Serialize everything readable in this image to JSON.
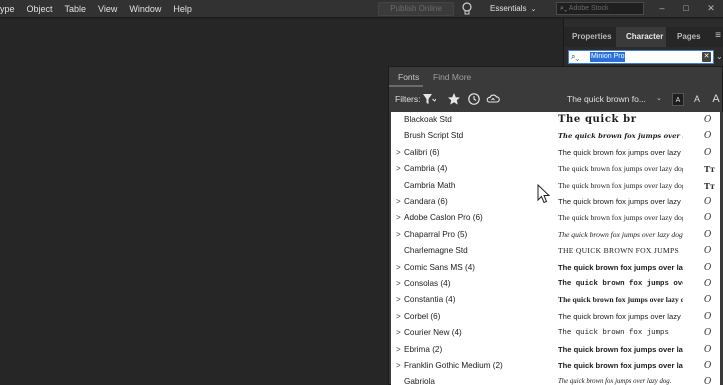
{
  "menubar": {
    "items": [
      "ype",
      "Object",
      "Table",
      "View",
      "Window",
      "Help"
    ],
    "publish_label": "Publish Online",
    "workspace_label": "Essentials",
    "stock_placeholder": "Adobe Stock"
  },
  "right_panel": {
    "tabs": [
      "Properties",
      "Character",
      "Pages"
    ],
    "font_field_value": "Minion Pro"
  },
  "fonts_popup": {
    "tabs": [
      "Fonts",
      "Find More"
    ],
    "filters_label": "Filters:",
    "preview_text": "The quick brown fo...",
    "size_buttons": [
      "A",
      "A",
      "A"
    ],
    "rows": [
      {
        "name": "Blackoak Std",
        "expand": "",
        "sample": "The quick br",
        "type": "O"
      },
      {
        "name": "Brush Script Std",
        "expand": "",
        "sample": "The quick brown fox jumps over lazy dog",
        "type": "O"
      },
      {
        "name": "Calibri (6)",
        "expand": ">",
        "sample": "The quick brown fox jumps over lazy dog",
        "type": "O"
      },
      {
        "name": "Cambria (4)",
        "expand": ">",
        "sample": "The quick brown fox jumps over lazy dog",
        "type": "TT"
      },
      {
        "name": "Cambria Math",
        "expand": "",
        "sample": "The quick brown fox jumps over lazy dog",
        "type": "TT"
      },
      {
        "name": "Candara (6)",
        "expand": ">",
        "sample": "The quick brown fox jumps over lazy dog",
        "type": "O"
      },
      {
        "name": "Adobe Caslon Pro (6)",
        "expand": ">",
        "sample": "The quick brown fox jumps over lazy dog",
        "type": "O"
      },
      {
        "name": "Chaparral Pro (5)",
        "expand": ">",
        "sample": "The quick brown fox jumps over lazy dog",
        "type": "O"
      },
      {
        "name": "Charlemagne Std",
        "expand": "",
        "sample": "THE QUICK BROWN FOX JUMPS",
        "type": "O"
      },
      {
        "name": "Comic Sans MS (4)",
        "expand": ">",
        "sample": "The quick brown fox jumps over lazy dog",
        "type": "O"
      },
      {
        "name": "Consolas (4)",
        "expand": ">",
        "sample": "The quick brown fox jumps over",
        "type": "O"
      },
      {
        "name": "Constantia (4)",
        "expand": ">",
        "sample": "The quick brown fox jumps over lazy dog",
        "type": "O"
      },
      {
        "name": "Corbel (6)",
        "expand": ">",
        "sample": "The quick brown fox jumps over lazy dog",
        "type": "O"
      },
      {
        "name": "Courier New (4)",
        "expand": ">",
        "sample": "The quick brown fox jumps",
        "type": "O"
      },
      {
        "name": "Ebrima (2)",
        "expand": ">",
        "sample": "The quick brown fox jumps over lazy dog",
        "type": "O"
      },
      {
        "name": "Franklin Gothic Medium (2)",
        "expand": ">",
        "sample": "The quick brown fox jumps over lazy dog",
        "type": "O"
      },
      {
        "name": "Gabriola",
        "expand": "",
        "sample": "The quick brown fox jumps over lazy dog.",
        "type": "O"
      }
    ]
  },
  "icons": [
    "filter-icon",
    "star-icon",
    "clock-icon",
    "cloud-sync-icon",
    "bulb-icon",
    "search-icon",
    "cursor-icon"
  ]
}
